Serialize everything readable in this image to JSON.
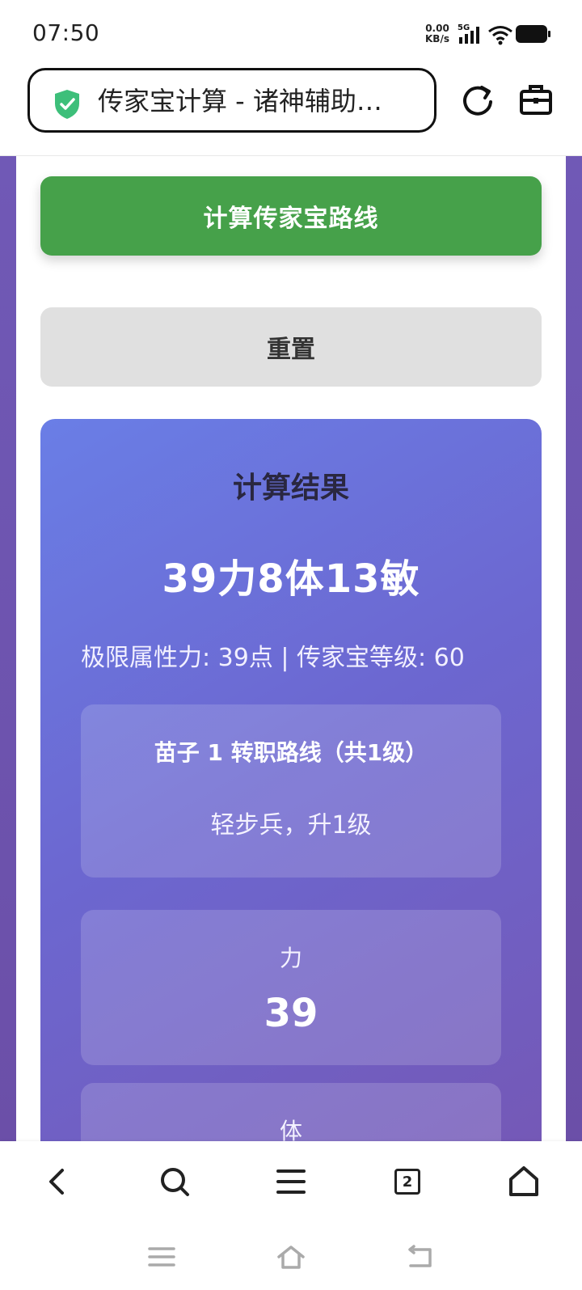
{
  "status_bar": {
    "time": "07:50",
    "net_speed_value": "0.00",
    "net_speed_unit": "KB/s",
    "network": "5G"
  },
  "address_bar": {
    "title": "传家宝计算 - 诸神辅助…"
  },
  "buttons": {
    "calculate": "计算传家宝路线",
    "reset": "重置"
  },
  "result": {
    "heading": "计算结果",
    "main": "39力8体13敏",
    "info": "极限属性力: 39点 | 传家宝等级: 60",
    "route": {
      "title": "苗子 1 转职路线（共1级）",
      "detail": "轻步兵，升1级"
    },
    "stats": [
      {
        "label": "力",
        "value": "39"
      },
      {
        "label": "体",
        "value": ""
      }
    ]
  },
  "bottom_nav": {
    "tab_count": "2"
  },
  "colors": {
    "calc_button": "#46a14a",
    "reset_button": "#e0e0e0",
    "panel_start": "#6a7ee6",
    "panel_end": "#7557b4",
    "shield": "#3dbf7a"
  },
  "icons": {
    "status": [
      "signal-icon",
      "wifi-icon",
      "battery-icon"
    ],
    "address": [
      "shield-icon",
      "reload-icon",
      "toolbox-icon"
    ],
    "nav": [
      "back-icon",
      "search-icon",
      "menu-icon",
      "tabs-icon",
      "home-icon"
    ],
    "system": [
      "system-menu-icon",
      "system-home-icon",
      "system-back-icon"
    ]
  }
}
